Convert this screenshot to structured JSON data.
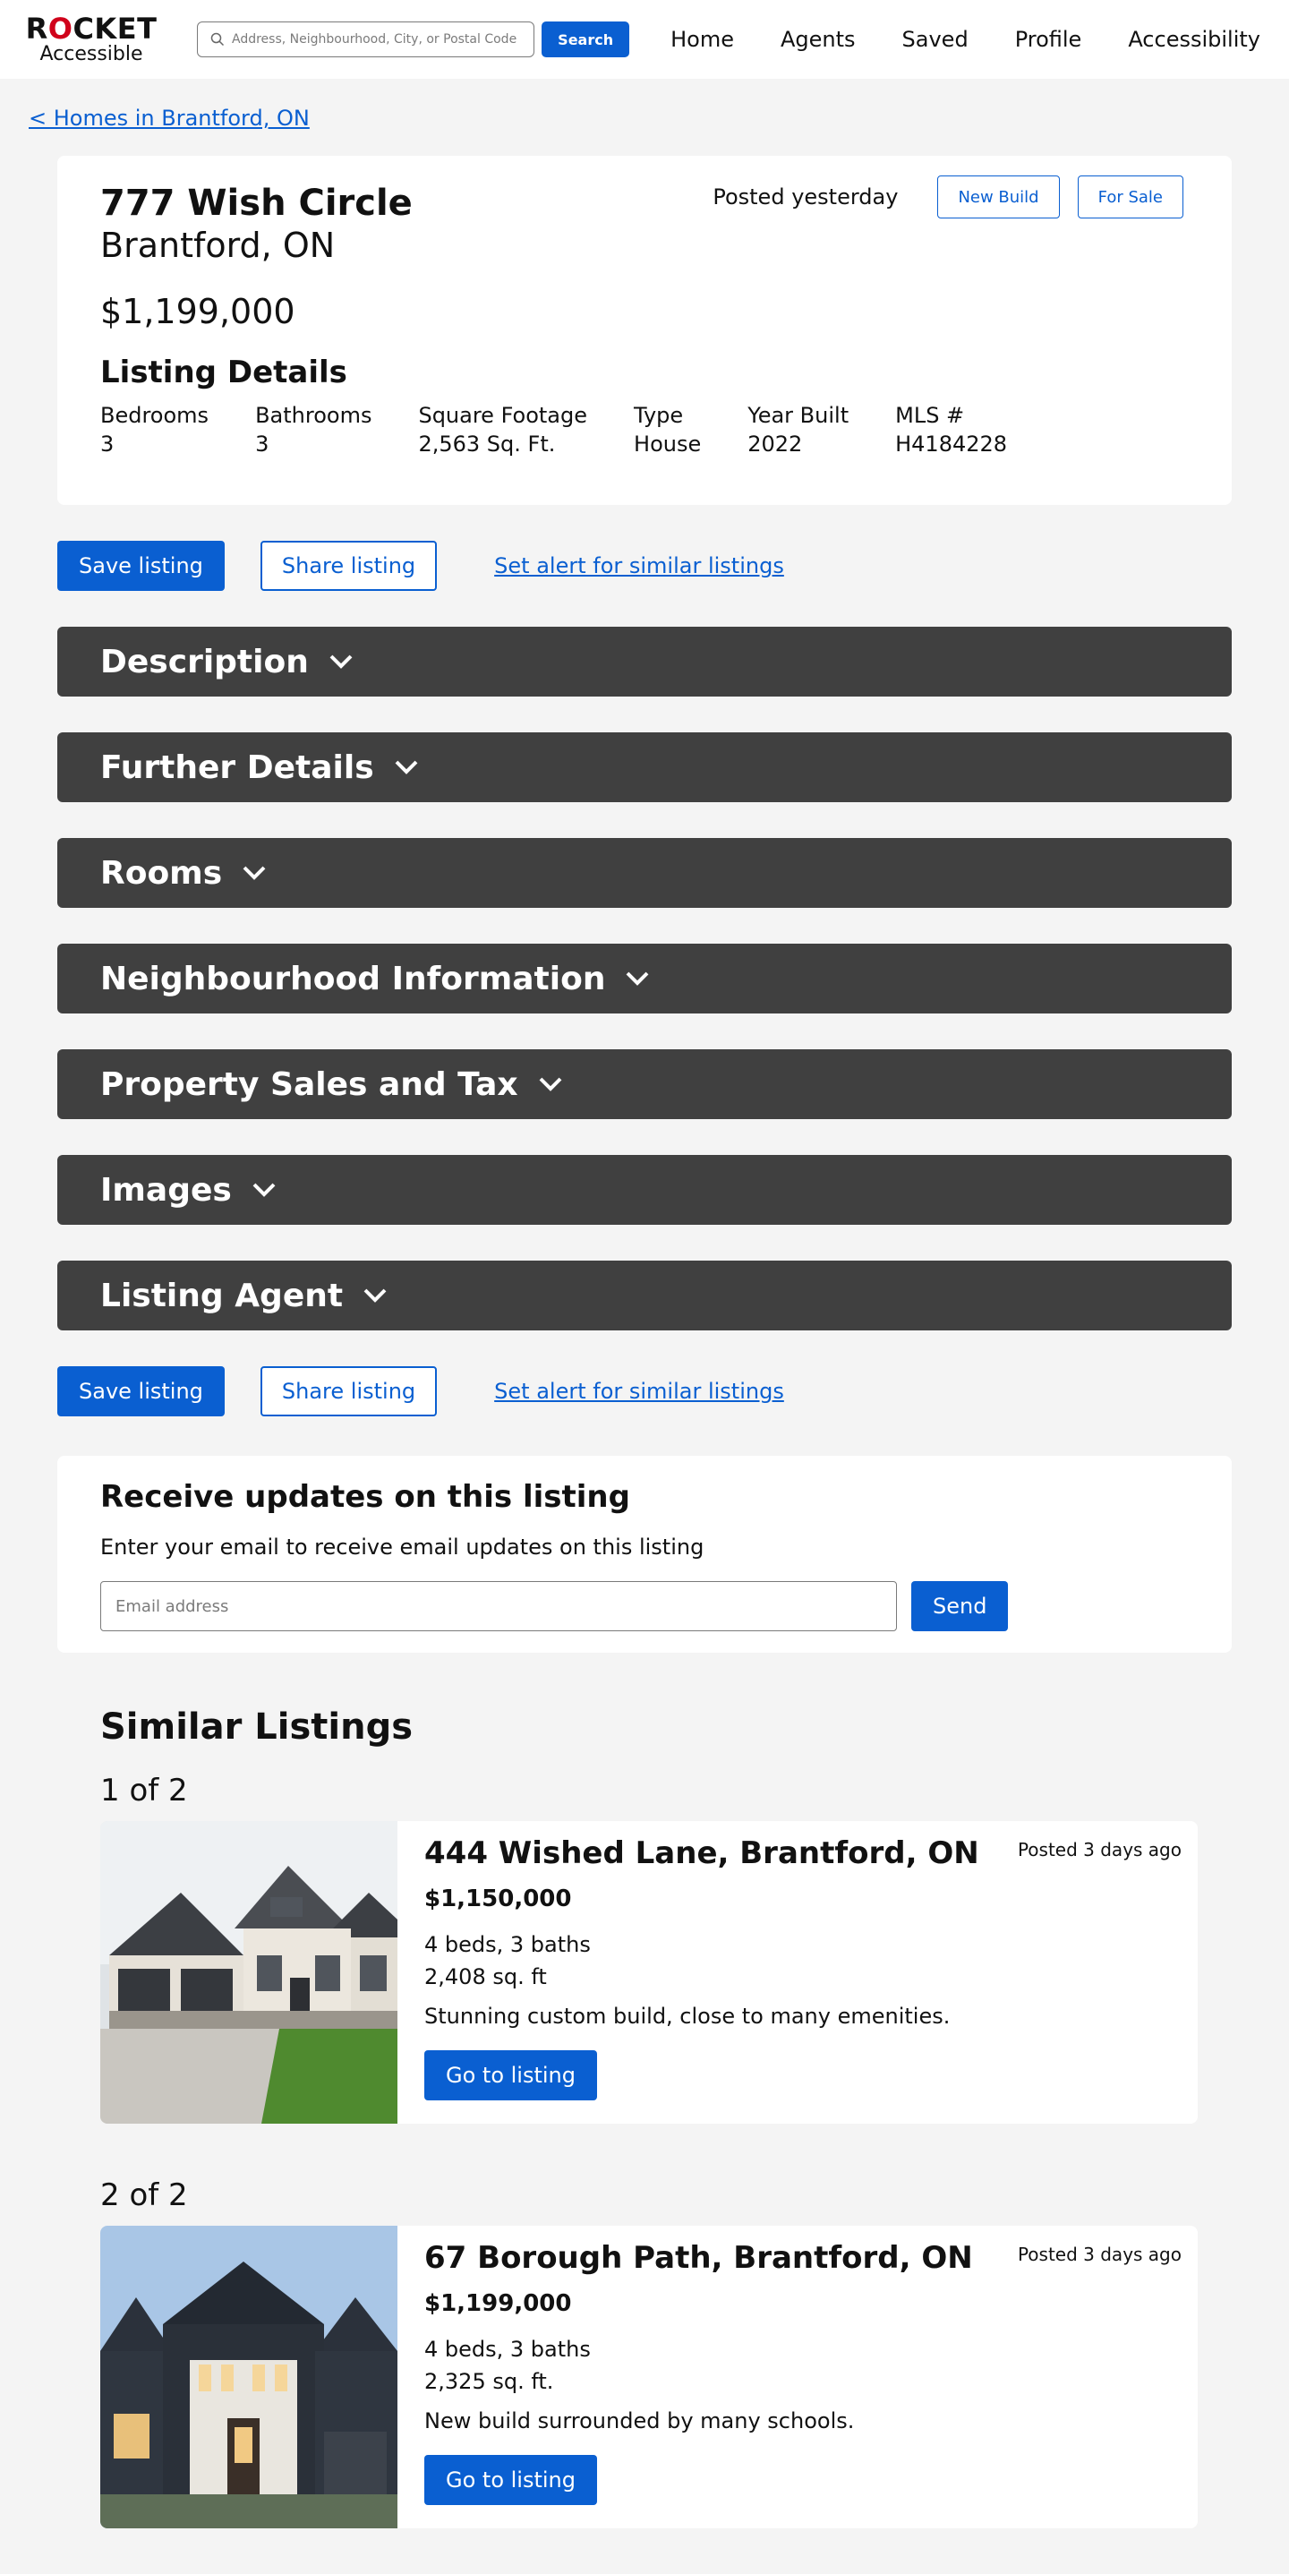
{
  "header": {
    "logo_top_1": "R",
    "logo_top_o": "O",
    "logo_top_2": "CKET",
    "logo_bottom": "Accessible",
    "search_placeholder": "Address, Neighbourhood, City, or Postal Code",
    "search_button": "Search",
    "nav": [
      "Home",
      "Agents",
      "Saved",
      "Profile",
      "Accessibility"
    ]
  },
  "breadcrumb": "< Homes in Brantford, ON",
  "listing": {
    "street": "777 Wish Circle",
    "city": "Brantford, ON",
    "price": "$1,199,000",
    "posted": "Posted yesterday",
    "badges": [
      "New Build",
      "For Sale"
    ],
    "details_title": "Listing Details",
    "details": [
      {
        "label": "Bedrooms",
        "value": "3"
      },
      {
        "label": "Bathrooms",
        "value": "3"
      },
      {
        "label": "Square Footage",
        "value": "2,563 Sq. Ft."
      },
      {
        "label": "Type",
        "value": "House"
      },
      {
        "label": "Year Built",
        "value": "2022"
      },
      {
        "label": "MLS #",
        "value": "H4184228"
      }
    ]
  },
  "actions": {
    "save": "Save listing",
    "share": "Share listing",
    "alert": "Set alert for similar listings"
  },
  "sections": [
    "Description",
    "Further Details",
    "Rooms",
    "Neighbourhood Information",
    "Property Sales and Tax",
    "Images",
    "Listing Agent"
  ],
  "updates": {
    "title": "Receive updates on this listing",
    "text": "Enter your email to receive email updates on this listing",
    "placeholder": "Email address",
    "send": "Send"
  },
  "similar": {
    "title": "Similar Listings",
    "items": [
      {
        "counter": "1 of 2",
        "title": "444 Wished Lane, Brantford, ON",
        "price": "$1,150,000",
        "beds_baths": "4 beds, 3 baths",
        "sqft": "2,408 sq. ft",
        "desc": "Stunning custom build, close to many emenities.",
        "posted": "Posted 3 days ago",
        "button": "Go to listing"
      },
      {
        "counter": "2 of 2",
        "title": "67 Borough Path, Brantford, ON",
        "price": "$1,199,000",
        "beds_baths": "4 beds, 3 baths",
        "sqft": "2,325 sq. ft.",
        "desc": "New build surrounded by many schools.",
        "posted": "Posted 3 days ago",
        "button": "Go to listing"
      }
    ]
  },
  "colors": {
    "primary": "#0a5fd1",
    "accordion": "#404040",
    "logo_accent": "#d0021b",
    "page_bg": "#f4f4f4"
  }
}
